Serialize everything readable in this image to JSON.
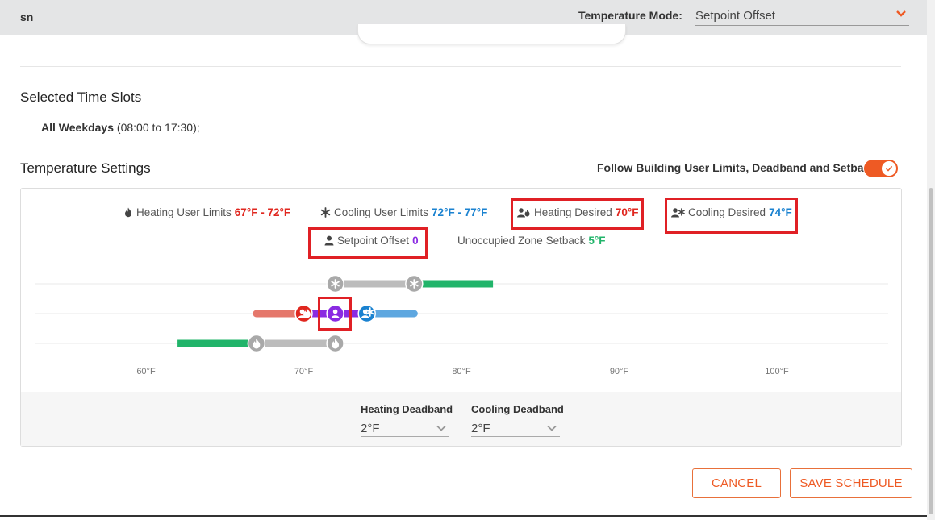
{
  "header": {
    "app_name": "sn",
    "mode_label": "Temperature Mode:",
    "mode_value": "Setpoint Offset"
  },
  "slots": {
    "title": "Selected Time Slots",
    "day_label": "All Weekdays",
    "time_range": " (08:00 to 17:30);"
  },
  "temperature": {
    "title": "Temperature Settings",
    "follow_label": "Follow Building User Limits, Deadband and Setback",
    "follow_enabled": true
  },
  "legend": {
    "heating_limits_label": "Heating User Limits",
    "heating_limits_value": "67°F - 72°F",
    "cooling_limits_label": "Cooling User Limits",
    "cooling_limits_value": "72°F - 77°F",
    "heating_desired_label": "Heating Desired",
    "heating_desired_value": "70°F",
    "cooling_desired_label": "Cooling Desired",
    "cooling_desired_value": "74°F",
    "setpoint_label": "Setpoint Offset",
    "setpoint_value": "0",
    "setback_label": "Unoccupied Zone Setback",
    "setback_value": "5°F"
  },
  "chart_data": {
    "type": "range",
    "x_ticks": [
      "60°F",
      "70°F",
      "80°F",
      "90°F",
      "100°F"
    ],
    "x_tick_values": [
      60,
      70,
      80,
      90,
      100
    ],
    "cooling_limits": [
      72,
      77
    ],
    "cooling_setback": [
      77,
      82
    ],
    "heating_limits": [
      67,
      72
    ],
    "heating_setback": [
      62,
      67
    ],
    "heating_desired": 70,
    "cooling_desired": 74,
    "setpoint": 72,
    "comfort_range": [
      67,
      77
    ]
  },
  "deadband": {
    "heating_label": "Heating Deadband",
    "heating_value": "2°F",
    "cooling_label": "Cooling Deadband",
    "cooling_value": "2°F"
  },
  "buttons": {
    "cancel": "CANCEL",
    "save": "SAVE SCHEDULE"
  },
  "colors": {
    "accent": "#ee5a24",
    "heating": "#e0271f",
    "cooling": "#1a82d0",
    "setback": "#21b46a",
    "setpoint": "#8a2be2",
    "highlight": "#e02025"
  }
}
